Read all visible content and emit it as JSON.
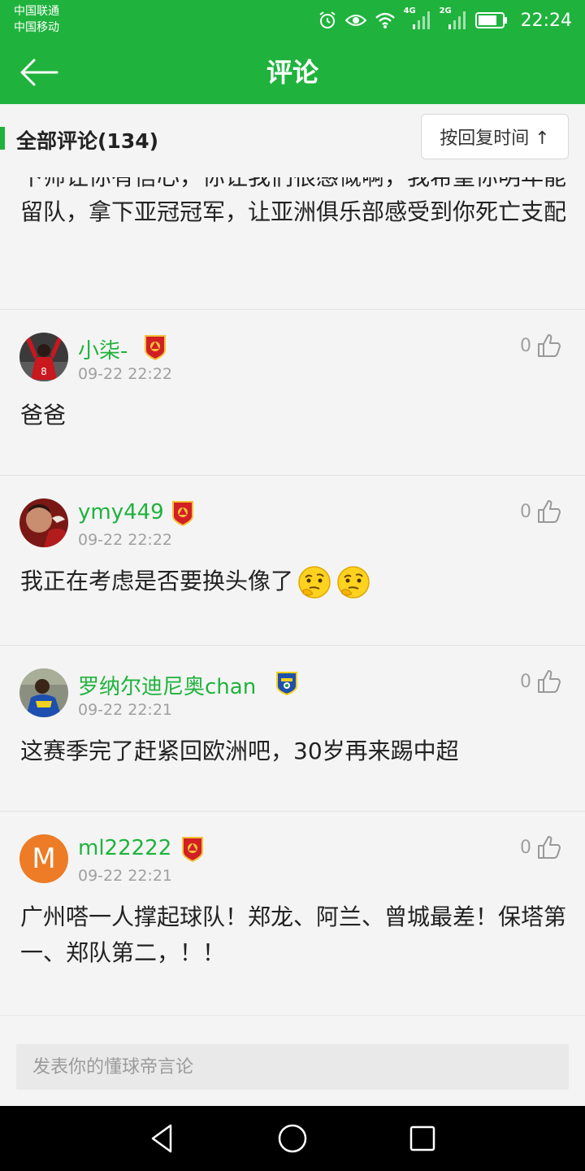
{
  "status_bar": {
    "carrier_1": "中国联通",
    "carrier_2": "中国移动",
    "network_1": "4G",
    "network_2": "2G",
    "time": "22:24"
  },
  "header": {
    "title": "评论"
  },
  "section": {
    "title": "全部评论(134)",
    "sort_label": "按回复时间 ↑"
  },
  "partial_comment": {
    "text": "下师让你有信心，你让我们很感慨啊，我希望你明年能留队，拿下亚冠冠军，让亚洲俱乐部感受到你死亡支配"
  },
  "comments": [
    {
      "username": "小柒-",
      "time": "09-22 22:22",
      "likes": "0",
      "text": "爸爸",
      "badge": "team-crest"
    },
    {
      "username": "ymy449",
      "time": "09-22 22:22",
      "likes": "0",
      "text": "我正在考虑是否要换头像了",
      "emoji": [
        "thinking-face-icon",
        "thinking-face-icon"
      ],
      "badge": "team-crest"
    },
    {
      "username": "罗纳尔迪尼奥chan",
      "time": "09-22 22:21",
      "likes": "0",
      "text": "这赛季完了赶紧回欧洲吧，30岁再来踢中超",
      "badge": "brazil-crest"
    },
    {
      "username": "ml22222",
      "avatar_letter": "M",
      "time": "09-22 22:21",
      "likes": "0",
      "text": "广州嗒一人撑起球队！郑龙、阿兰、曾城最差！保塔第一、郑队第二，！！",
      "badge": "team-crest"
    }
  ],
  "input": {
    "placeholder": "发表你的懂球帝言论"
  },
  "colors": {
    "brand_green": "#1fb33d",
    "avatar_orange": "#ee7b26",
    "muted_gray": "#a0a0a0"
  }
}
